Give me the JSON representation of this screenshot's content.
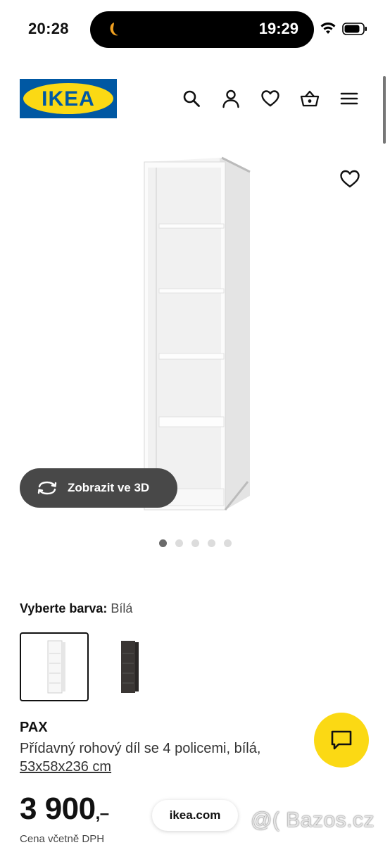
{
  "status_bar": {
    "time": "20:28",
    "island_time": "19:29"
  },
  "header": {
    "logo_text": "IKEA",
    "icons": [
      "search-icon",
      "user-icon",
      "heart-icon",
      "basket-icon",
      "menu-icon"
    ]
  },
  "gallery": {
    "view_3d_label": "Zobrazit ve 3D",
    "image_count": 5,
    "active_index": 0
  },
  "color_select": {
    "label": "Vyberte barva:",
    "value": "Bílá",
    "swatches": [
      "Bílá",
      "černohnědá"
    ]
  },
  "product": {
    "name": "PAX",
    "description": "Přídavný rohový díl se 4 policemi, bílá,",
    "dimensions": "53x58x236 cm",
    "price": "3 900",
    "price_suffix": ",–",
    "price_note": "Cena včetně DPH"
  },
  "browser": {
    "url": "ikea.com"
  },
  "watermark": "@( Bazos.cz",
  "colors": {
    "ikea_blue": "#0058a3",
    "ikea_yellow": "#fbd914",
    "button_dark": "#484848"
  }
}
